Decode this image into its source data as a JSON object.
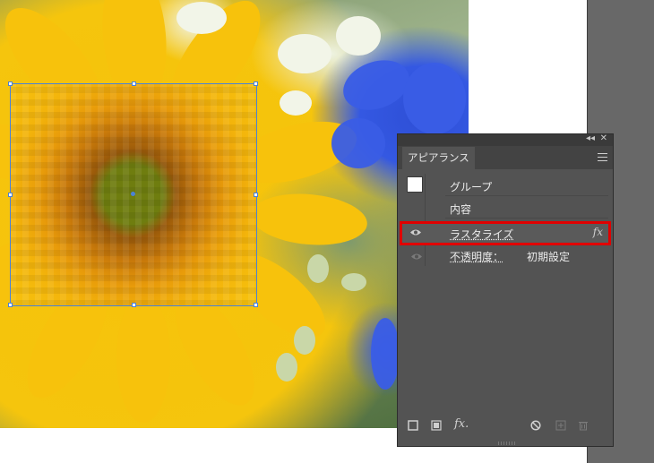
{
  "panel": {
    "tab_label": "アピアランス",
    "rows": {
      "group_label": "グループ",
      "content_label": "内容",
      "rasterize_label": "ラスタライズ",
      "rasterize_fx": "fx",
      "opacity_label": "不透明度：",
      "opacity_value": "初期設定"
    },
    "bottom_fx": "fx."
  },
  "icons": {
    "collapse": "double-chevron-left-icon",
    "close": "close-icon",
    "menu": "hamburger-menu-icon",
    "visibility": "eye-icon"
  },
  "colors": {
    "highlight": "#e00000",
    "selection": "#4b82d6",
    "panel_bg": "#535353"
  }
}
